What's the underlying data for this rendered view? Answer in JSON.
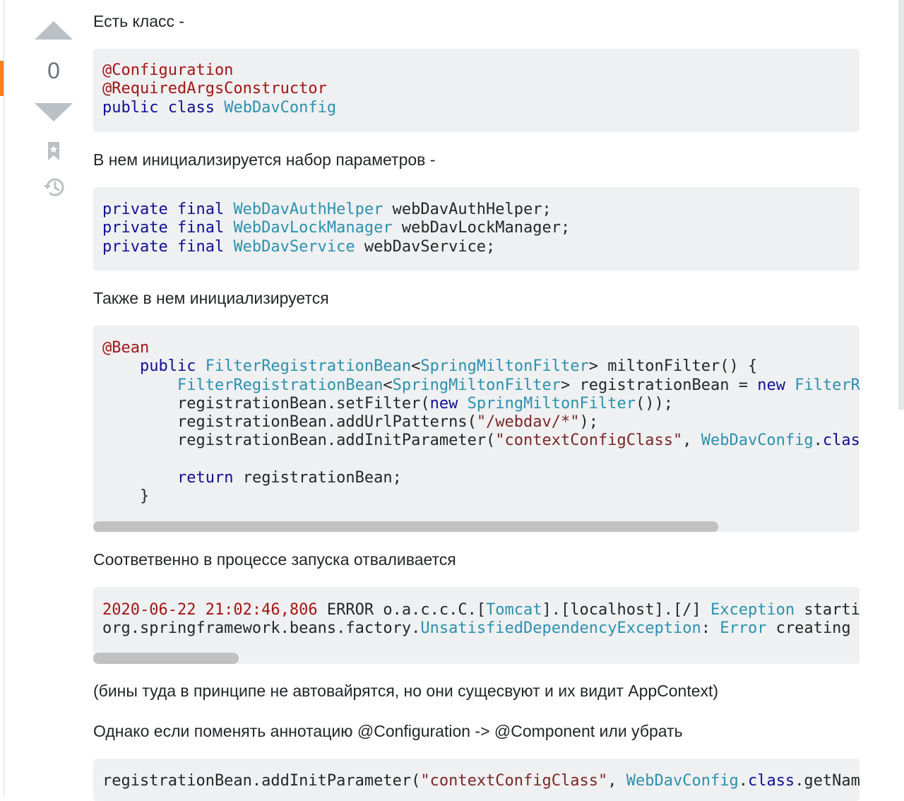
{
  "vote": {
    "count": "0"
  },
  "post": {
    "para1": "Есть класс -",
    "para2": "В нем инициализируется набор параметров -",
    "para3": "Также в нем инициализируется",
    "para4": "Соответвенно в процессе запуска отваливается",
    "para5": "(бины туда в принципе не автовайрятся, но они сущесвуют и их видит AppContext)",
    "para6": "Однако если поменять аннотацию @Configuration -> @Component или убрать"
  },
  "code1": {
    "line1": "@Configuration",
    "line2": "@RequiredArgsConstructor",
    "line3_kw": "public class",
    "line3_type": "WebDavConfig"
  },
  "code2": {
    "kw": "private final",
    "l1_type": "WebDavAuthHelper",
    "l1_name": " webDavAuthHelper;",
    "l2_type": "WebDavLockManager",
    "l2_name": " webDavLockManager;",
    "l3_type": "WebDavService",
    "l3_name": " webDavService;"
  },
  "code3": {
    "ann": "@Bean",
    "l2_kw": "public",
    "l2_type1": "FilterRegistrationBean",
    "l2_type2": "SpringMiltonFilter",
    "l2_rest": "> miltonFilter() {",
    "l3_type1": "FilterRegistrationBean",
    "l3_type2": "SpringMiltonFilter",
    "l3_mid": "> registrationBean = ",
    "l3_kw": "new",
    "l3_type3": "FilterReg",
    "l4_pre": "registrationBean.setFilter(",
    "l4_kw": "new",
    "l4_type": "SpringMiltonFilter",
    "l4_post": "());",
    "l5_pre": "registrationBean.addUrlPatterns(",
    "l5_str": "\"/webdav/*\"",
    "l5_post": ");",
    "l6_pre": "registrationBean.addInitParameter(",
    "l6_str": "\"contextConfigClass\"",
    "l6_type": "WebDavConfig",
    "l6_kw": "class",
    "l6_post": ".",
    "l8_kw": "return",
    "l8_rest": " registrationBean;",
    "l9": "}",
    "scroll_fraction": 0.816
  },
  "code4": {
    "l1_date": "2020-06-22 21:02:46,806",
    "l1_mid1": " ERROR o.a.c.c.C.[",
    "l1_type1": "Tomcat",
    "l1_mid2": "].[localhost].[/] ",
    "l1_type2": "Exception",
    "l1_rest": " starting",
    "l2_pre": "org.springframework.beans.factory.",
    "l2_type1": "UnsatisfiedDependencyException",
    "l2_mid": ": ",
    "l2_type2": "Error",
    "l2_rest": " creating be",
    "scroll_fraction": 0.19
  },
  "code5": {
    "pre": "registrationBean.addInitParameter(",
    "str": "\"contextConfigClass\"",
    "type": "WebDavConfig",
    "kw": "class",
    "post": ".getName("
  },
  "colors": {
    "accent": "#f48024",
    "code_bg": "#eff0f1",
    "keyword": "#101094",
    "type": "#2b91af",
    "annotation": "#a31515"
  }
}
